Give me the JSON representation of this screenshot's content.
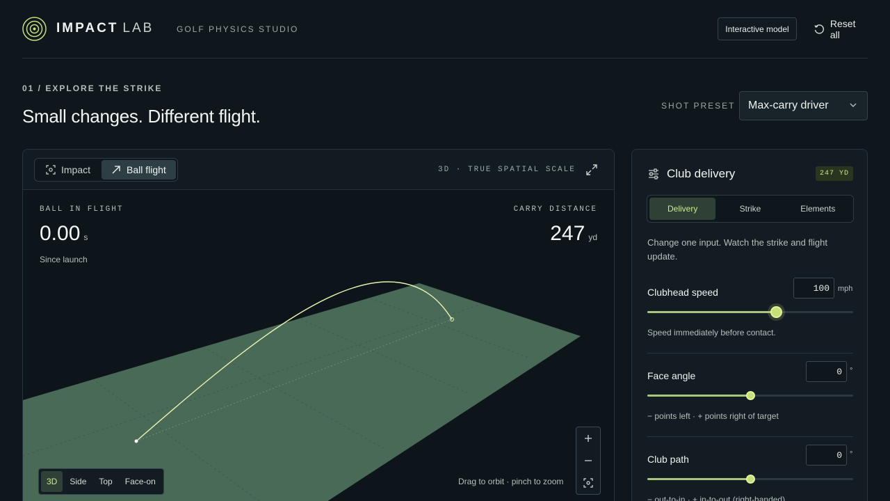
{
  "header": {
    "brand_bold": "IMPACT",
    "brand_light": "LAB",
    "subtitle": "GOLF PHYSICS STUDIO",
    "interactive_model_label": "Interactive model",
    "reset_label": "Reset all"
  },
  "section": {
    "eyebrow": "01 / EXPLORE THE STRIKE",
    "headline": "Small changes. Different flight.",
    "preset_label": "SHOT PRESET",
    "preset_value": "Max-carry driver"
  },
  "viewer": {
    "mode_tabs": [
      {
        "label": "Impact",
        "icon": "target-icon",
        "active": false
      },
      {
        "label": "Ball flight",
        "icon": "arrow-up-right-icon",
        "active": true
      }
    ],
    "scale_label": "3D · TRUE SPATIAL SCALE",
    "flight_label": "BALL IN FLIGHT",
    "flight_value": "0.00",
    "flight_unit": "s",
    "flight_sub": "Since launch",
    "carry_label": "CARRY DISTANCE",
    "carry_value": "247",
    "carry_unit": "yd",
    "view_buttons": [
      {
        "label": "3D",
        "active": true
      },
      {
        "label": "Side",
        "active": false
      },
      {
        "label": "Top",
        "active": false
      },
      {
        "label": "Face-on",
        "active": false
      }
    ],
    "hint": "Drag to orbit · pinch to zoom"
  },
  "panel": {
    "title": "Club delivery",
    "badge": "247 YD",
    "tabs": [
      {
        "label": "Delivery",
        "active": true
      },
      {
        "label": "Strike",
        "active": false
      },
      {
        "label": "Elements",
        "active": false
      }
    ],
    "description": "Change one input. Watch the strike and flight update.",
    "controls": [
      {
        "label": "Clubhead speed",
        "value": "100",
        "unit": "mph",
        "fraction": 0.625,
        "help": "Speed immediately before contact."
      },
      {
        "label": "Face angle",
        "value": "0",
        "unit": "°",
        "fraction": 0.5,
        "help": "− points left · + points right of target"
      },
      {
        "label": "Club path",
        "value": "0",
        "unit": "°",
        "fraction": 0.5,
        "help": "− out-to-in · + in-to-out (right-handed)"
      }
    ]
  },
  "colors": {
    "accent": "#c5e07a",
    "ground": "#4a6a58",
    "background": "#0f171c"
  }
}
